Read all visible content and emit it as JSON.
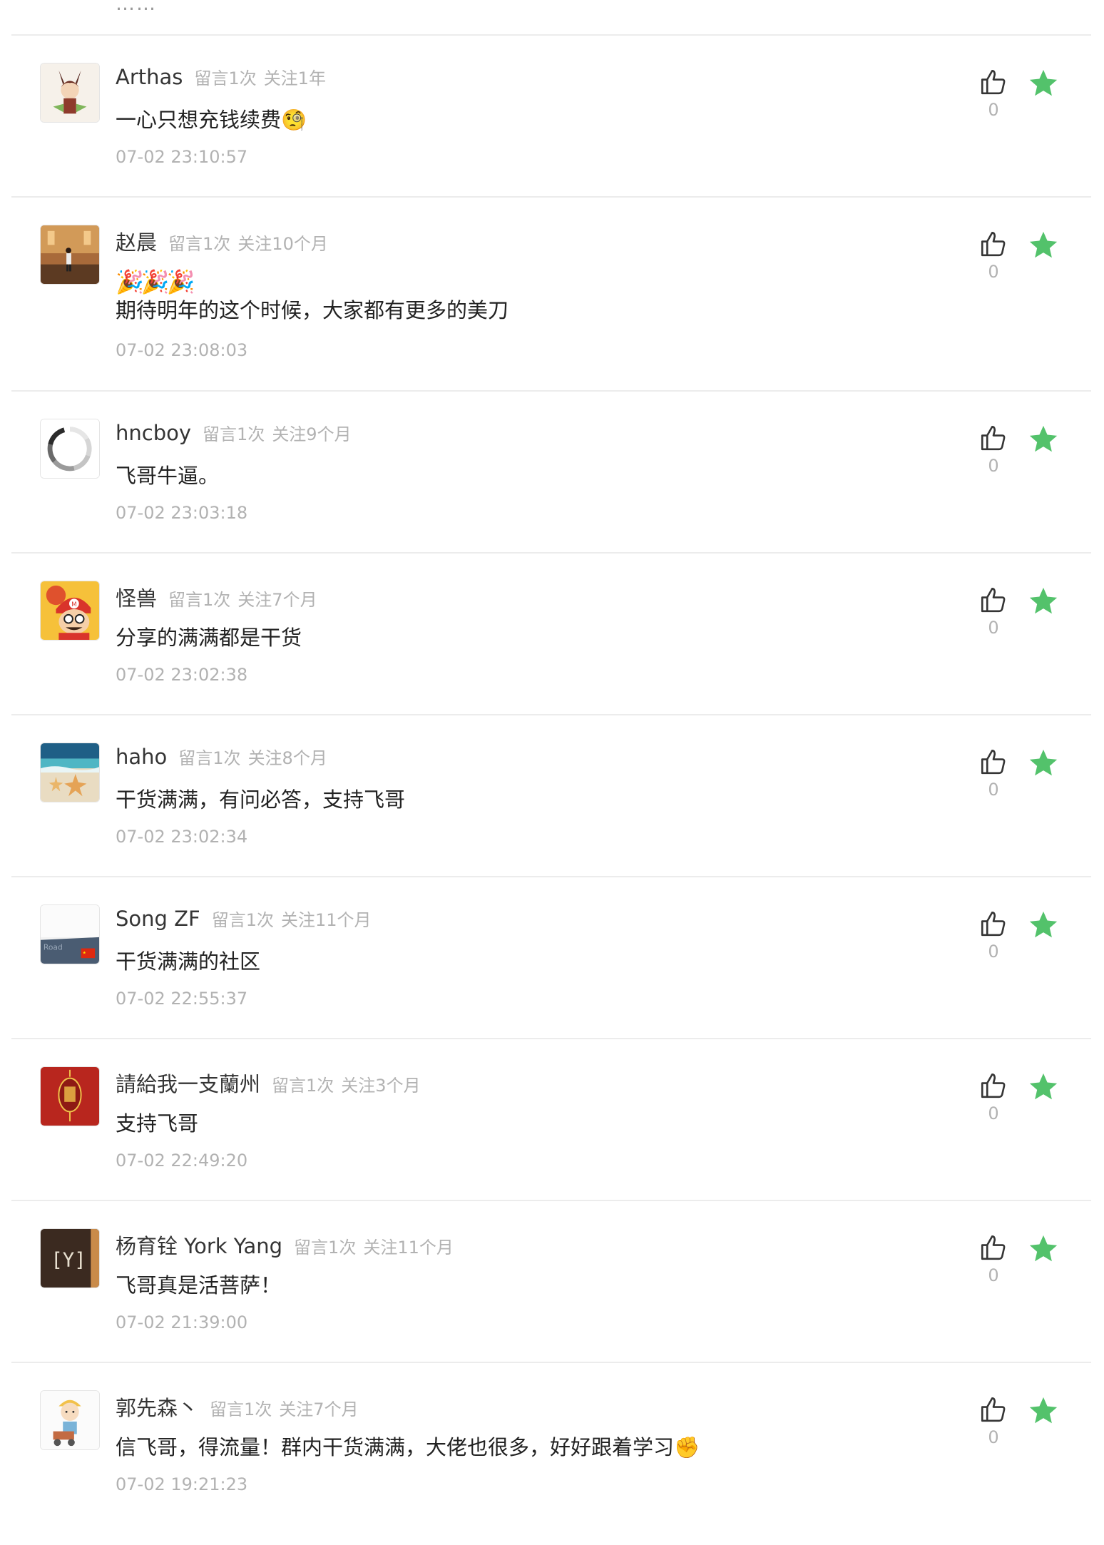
{
  "top_partial_text": "……",
  "colors": {
    "star": "#53C26B",
    "username": "#353535",
    "meta": "#B2B2B2",
    "divider": "#ECECEC"
  },
  "comments": [
    {
      "username": "Arthas",
      "meta_messages": "留言1次",
      "meta_follow": "关注1年",
      "emoji": "",
      "text": "一心只想充钱续费🧐",
      "time": "07-02 23:10:57",
      "likes": "0",
      "avatar": "anime-character-avatar"
    },
    {
      "username": "赵晨",
      "meta_messages": "留言1次",
      "meta_follow": "关注10个月",
      "emoji": "🎉🎉🎉",
      "text": "期待明年的这个时候，大家都有更多的美刀",
      "time": "07-02 23:08:03",
      "likes": "0",
      "avatar": "person-photo-avatar"
    },
    {
      "username": "hncboy",
      "meta_messages": "留言1次",
      "meta_follow": "关注9个月",
      "emoji": "",
      "text": "飞哥牛逼。",
      "time": "07-02 23:03:18",
      "likes": "0",
      "avatar": "loading-spinner-avatar"
    },
    {
      "username": "怪兽",
      "meta_messages": "留言1次",
      "meta_follow": "关注7个月",
      "emoji": "",
      "text": "分享的满满都是干货",
      "time": "07-02 23:02:38",
      "likes": "0",
      "avatar": "mario-cartoon-avatar"
    },
    {
      "username": "haho",
      "meta_messages": "留言1次",
      "meta_follow": "关注8个月",
      "emoji": "",
      "text": "干货满满，有问必答，支持飞哥",
      "time": "07-02 23:02:34",
      "likes": "0",
      "avatar": "starfish-beach-avatar"
    },
    {
      "username": "Song ZF",
      "meta_messages": "留言1次",
      "meta_follow": "关注11个月",
      "emoji": "",
      "text": "干货满满的社区",
      "time": "07-02 22:55:37",
      "likes": "0",
      "avatar": "road-flag-avatar"
    },
    {
      "username": "請給我一支蘭州",
      "meta_messages": "留言1次",
      "meta_follow": "关注3个月",
      "emoji": "",
      "text": "支持飞哥",
      "time": "07-02 22:49:20",
      "likes": "0",
      "avatar": "red-lantern-avatar"
    },
    {
      "username": "杨育铨 York Yang",
      "meta_messages": "留言1次",
      "meta_follow": "关注11个月",
      "emoji": "",
      "text": "飞哥真是活菩萨！",
      "time": "07-02 21:39:00",
      "likes": "0",
      "avatar": "y-bracket-avatar"
    },
    {
      "username": "郭先森丶",
      "meta_messages": "留言1次",
      "meta_follow": "关注7个月",
      "emoji": "",
      "text": "信飞哥，得流量！群内干货满满，大佬也很多，好好跟着学习✊",
      "time": "07-02 19:21:23",
      "likes": "0",
      "avatar": "cartoon-worker-avatar"
    }
  ]
}
